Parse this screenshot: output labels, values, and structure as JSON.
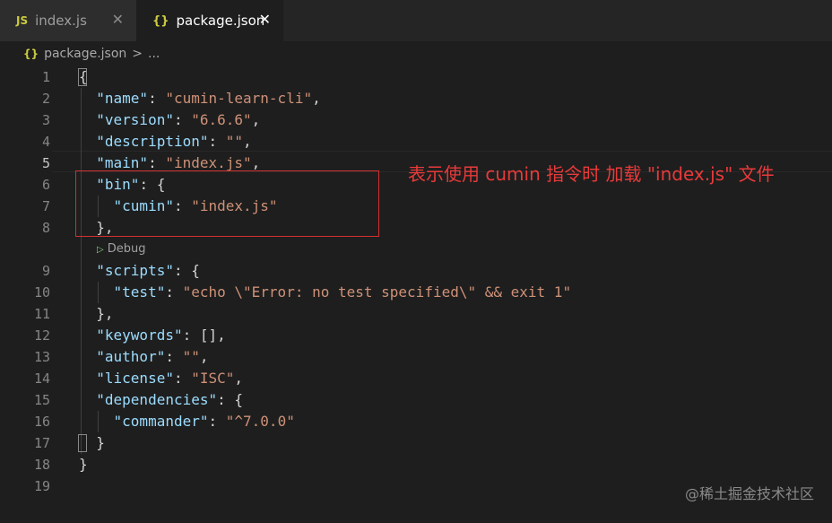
{
  "tabs": [
    {
      "icon": "JS",
      "label": "index.js",
      "close": "✕"
    },
    {
      "icon": "{}",
      "label": "package.json",
      "close": "✕"
    }
  ],
  "breadcrumb": {
    "icon": "{}",
    "file": "package.json",
    "sep": ">",
    "more": "..."
  },
  "lines": [
    {
      "n": "1",
      "tokens": [
        {
          "t": "p",
          "v": "{"
        }
      ]
    },
    {
      "n": "2",
      "tokens": [
        {
          "t": "p",
          "v": "  "
        },
        {
          "t": "k",
          "v": "\"name\""
        },
        {
          "t": "p",
          "v": ": "
        },
        {
          "t": "s",
          "v": "\"cumin-learn-cli\""
        },
        {
          "t": "p",
          "v": ","
        }
      ]
    },
    {
      "n": "3",
      "tokens": [
        {
          "t": "p",
          "v": "  "
        },
        {
          "t": "k",
          "v": "\"version\""
        },
        {
          "t": "p",
          "v": ": "
        },
        {
          "t": "s",
          "v": "\"6.6.6\""
        },
        {
          "t": "p",
          "v": ","
        }
      ]
    },
    {
      "n": "4",
      "tokens": [
        {
          "t": "p",
          "v": "  "
        },
        {
          "t": "k",
          "v": "\"description\""
        },
        {
          "t": "p",
          "v": ": "
        },
        {
          "t": "s",
          "v": "\"\""
        },
        {
          "t": "p",
          "v": ","
        }
      ]
    },
    {
      "n": "5",
      "tokens": [
        {
          "t": "p",
          "v": "  "
        },
        {
          "t": "k",
          "v": "\"main\""
        },
        {
          "t": "p",
          "v": ": "
        },
        {
          "t": "s",
          "v": "\"index.js\""
        },
        {
          "t": "p",
          "v": ","
        }
      ]
    },
    {
      "n": "6",
      "tokens": [
        {
          "t": "p",
          "v": "  "
        },
        {
          "t": "k",
          "v": "\"bin\""
        },
        {
          "t": "p",
          "v": ": {"
        }
      ]
    },
    {
      "n": "7",
      "tokens": [
        {
          "t": "p",
          "v": "    "
        },
        {
          "t": "k",
          "v": "\"cumin\""
        },
        {
          "t": "p",
          "v": ": "
        },
        {
          "t": "s",
          "v": "\"index.js\""
        }
      ]
    },
    {
      "n": "8",
      "tokens": [
        {
          "t": "p",
          "v": "  },"
        }
      ]
    },
    {
      "n": "",
      "lens": "Debug"
    },
    {
      "n": "9",
      "tokens": [
        {
          "t": "p",
          "v": "  "
        },
        {
          "t": "k",
          "v": "\"scripts\""
        },
        {
          "t": "p",
          "v": ": {"
        }
      ]
    },
    {
      "n": "10",
      "tokens": [
        {
          "t": "p",
          "v": "    "
        },
        {
          "t": "k",
          "v": "\"test\""
        },
        {
          "t": "p",
          "v": ": "
        },
        {
          "t": "s",
          "v": "\"echo \\\"Error: no test specified\\\" && exit 1\""
        }
      ]
    },
    {
      "n": "11",
      "tokens": [
        {
          "t": "p",
          "v": "  },"
        }
      ]
    },
    {
      "n": "12",
      "tokens": [
        {
          "t": "p",
          "v": "  "
        },
        {
          "t": "k",
          "v": "\"keywords\""
        },
        {
          "t": "p",
          "v": ": [],"
        }
      ]
    },
    {
      "n": "13",
      "tokens": [
        {
          "t": "p",
          "v": "  "
        },
        {
          "t": "k",
          "v": "\"author\""
        },
        {
          "t": "p",
          "v": ": "
        },
        {
          "t": "s",
          "v": "\"\""
        },
        {
          "t": "p",
          "v": ","
        }
      ]
    },
    {
      "n": "14",
      "tokens": [
        {
          "t": "p",
          "v": "  "
        },
        {
          "t": "k",
          "v": "\"license\""
        },
        {
          "t": "p",
          "v": ": "
        },
        {
          "t": "s",
          "v": "\"ISC\""
        },
        {
          "t": "p",
          "v": ","
        }
      ]
    },
    {
      "n": "15",
      "tokens": [
        {
          "t": "p",
          "v": "  "
        },
        {
          "t": "k",
          "v": "\"dependencies\""
        },
        {
          "t": "p",
          "v": ": {"
        }
      ]
    },
    {
      "n": "16",
      "tokens": [
        {
          "t": "p",
          "v": "    "
        },
        {
          "t": "k",
          "v": "\"commander\""
        },
        {
          "t": "p",
          "v": ": "
        },
        {
          "t": "s",
          "v": "\"^7.0.0\""
        }
      ]
    },
    {
      "n": "17",
      "tokens": [
        {
          "t": "p",
          "v": "  }"
        }
      ]
    },
    {
      "n": "18",
      "tokens": [
        {
          "t": "p",
          "v": "}"
        }
      ]
    },
    {
      "n": "19",
      "tokens": []
    }
  ],
  "active_line": "5",
  "annotation": "表示使用 cumin 指令时 加载 \"index.js\" 文件",
  "watermark": "@稀土掘金技术社区",
  "colors": {
    "key": "#9cdcfe",
    "string": "#ce9178",
    "punct": "#d4d4d4",
    "annotation": "#e83a3a",
    "editor_bg": "#1e1e1e",
    "tabbar_bg": "#252526"
  }
}
